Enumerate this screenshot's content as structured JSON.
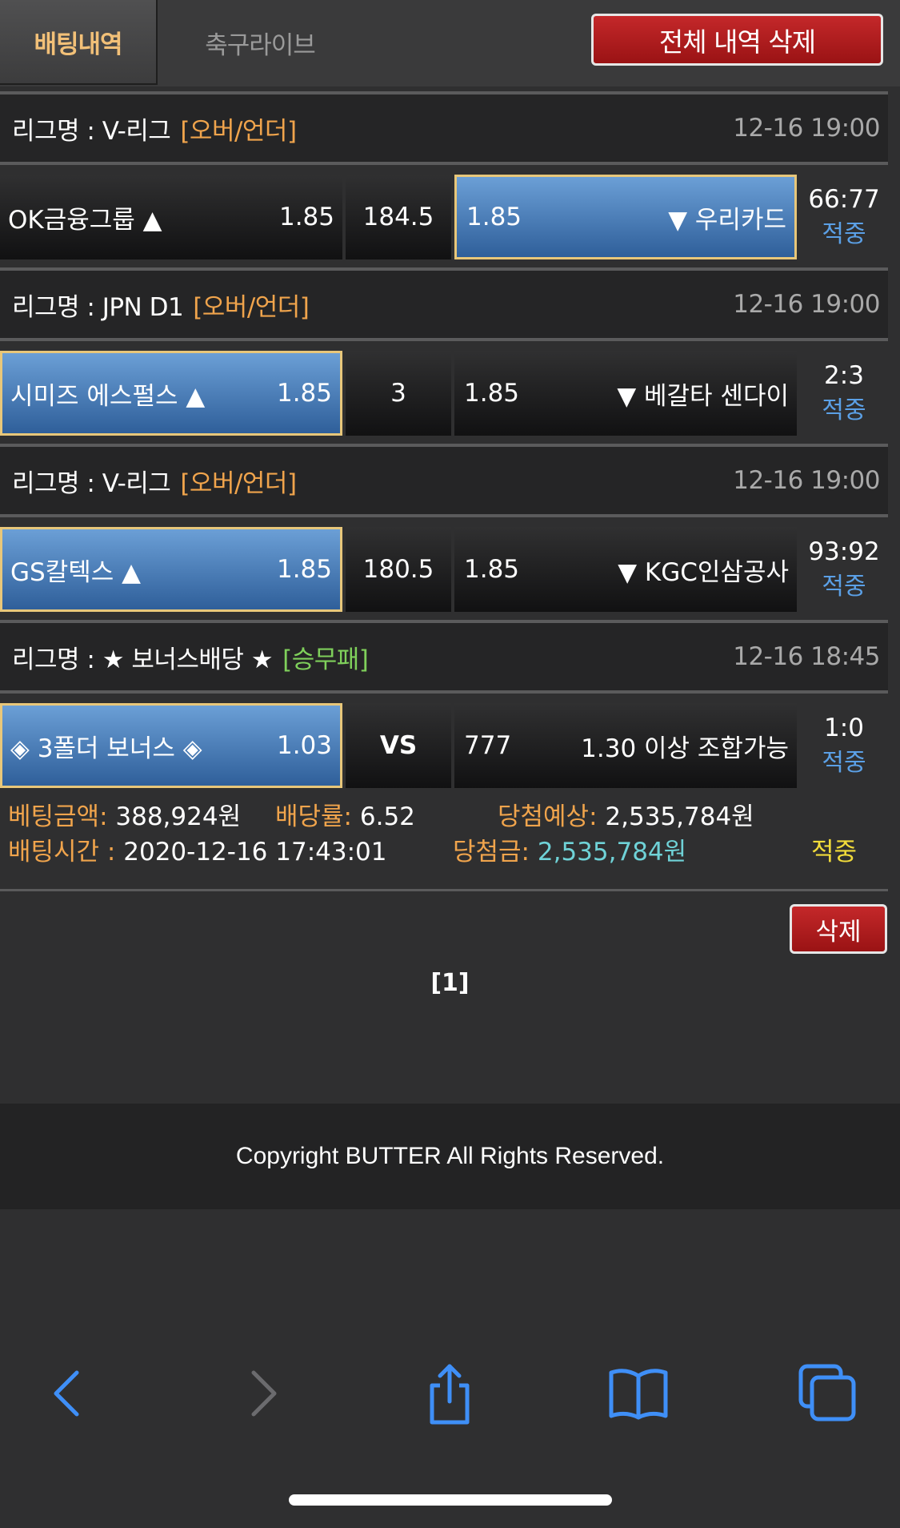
{
  "tabs": [
    {
      "label": "배팅내역"
    },
    {
      "label": "축구라이브"
    }
  ],
  "delete_all_label": "전체 내역 삭제",
  "bets": [
    {
      "league_prefix": "리그명 : V-리그",
      "bet_type": "[오버/언더]",
      "time": "12-16 19:00",
      "home": {
        "name": "OK금융그룹 ▲",
        "odds": "1.85"
      },
      "mid": "184.5",
      "away": {
        "name": "▼ 우리카드",
        "odds": "1.85"
      },
      "score": "66:77",
      "status": "적중"
    },
    {
      "league_prefix": "리그명 : JPN D1",
      "bet_type": "[오버/언더]",
      "time": "12-16 19:00",
      "home": {
        "name": "시미즈 에스펄스 ▲",
        "odds": "1.85"
      },
      "mid": "3",
      "away": {
        "name": "▼ 베갈타 센다이",
        "odds": "1.85"
      },
      "score": "2:3",
      "status": "적중"
    },
    {
      "league_prefix": "리그명 : V-리그",
      "bet_type": "[오버/언더]",
      "time": "12-16 19:00",
      "home": {
        "name": "GS칼텍스 ▲",
        "odds": "1.85"
      },
      "mid": "180.5",
      "away": {
        "name": "▼ KGC인삼공사",
        "odds": "1.85"
      },
      "score": "93:92",
      "status": "적중"
    },
    {
      "league_prefix": "리그명 : ★ 보너스배당 ★",
      "bet_type": "[승무패]",
      "time": "12-16 18:45",
      "home": {
        "name": "◈ 3폴더 보너스 ◈",
        "odds": "1.03"
      },
      "mid": "VS",
      "away": {
        "name": "1.30 이상 조합가능",
        "odds": "777"
      },
      "score": "1:0",
      "status": "적중"
    }
  ],
  "summary": {
    "bet_amount_label": "베팅금액:",
    "bet_amount": "388,924원",
    "odds_label": "배당률:",
    "odds": "6.52",
    "expected_label": "당첨예상:",
    "expected": "2,535,784원",
    "time_label": "배팅시간 :",
    "time": "2020-12-16 17:43:01",
    "win_label": "당첨금:",
    "win": "2,535,784원",
    "status": "적중"
  },
  "delete_label": "삭제",
  "pager": "[1]",
  "footer": "Copyright BUTTER All Rights Reserved.",
  "colors": {
    "accent_orange": "#f0a44c",
    "selected_blue": "#4f83c2",
    "hit_blue": "#5ba0e6",
    "delete_red": "#b01e20",
    "win_cyan": "#6fd2d7",
    "status_yellow": "#f2dc3a",
    "safari_blue": "#3f8ff7"
  },
  "safari_icons": [
    "back-icon",
    "forward-icon",
    "share-icon",
    "bookmarks-icon",
    "tabs-icon"
  ]
}
